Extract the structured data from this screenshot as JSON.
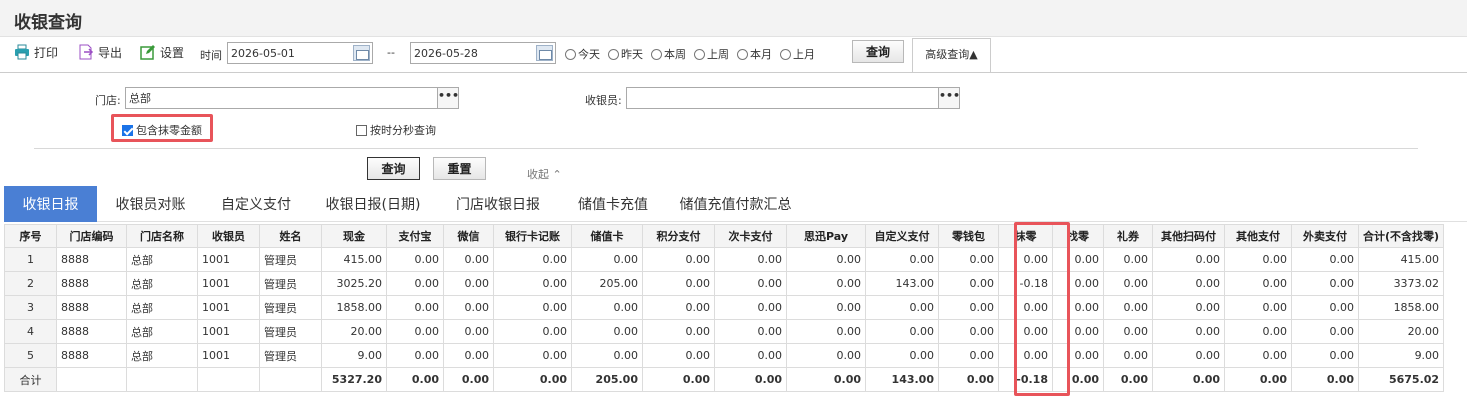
{
  "page": {
    "title": "收银查询"
  },
  "toolbar": {
    "print_label": "打印",
    "export_label": "导出",
    "settings_label": "设置",
    "time_label": "时间",
    "date_from": "2026-05-01",
    "date_sep": "--",
    "date_to": "2026-05-28",
    "radios": [
      "今天",
      "昨天",
      "本周",
      "上周",
      "本月",
      "上月"
    ],
    "query_label": "查询",
    "advanced_label": "高级查询▲"
  },
  "advanced": {
    "store_label": "门店:",
    "store_value": "总部",
    "cashier_label": "收银员:",
    "cashier_value": "",
    "dots": "•••",
    "include_rounding_label": "包含抹零金额",
    "include_rounding_checked": true,
    "by_seconds_label": "按时分秒查询",
    "by_seconds_checked": false,
    "query_label": "查询",
    "reset_label": "重置",
    "collapse_label": "收起 ⌃"
  },
  "tabs": [
    "收银日报",
    "收银员对账",
    "自定义支付",
    "收银日报(日期)",
    "门店收银日报",
    "储值卡充值",
    "储值充值付款汇总"
  ],
  "active_tab": 0,
  "table": {
    "columns": [
      "序号",
      "门店编码",
      "门店名称",
      "收银员",
      "姓名",
      "现金",
      "支付宝",
      "微信",
      "银行卡记账",
      "储值卡",
      "积分支付",
      "次卡支付",
      "思迅Pay",
      "自定义支付",
      "零钱包",
      "抹零",
      "找零",
      "礼券",
      "其他扫码付",
      "其他支付",
      "外卖支付",
      "合计(不含找零)"
    ],
    "rows": [
      [
        "1",
        "8888",
        "总部",
        "1001",
        "管理员",
        "415.00",
        "0.00",
        "0.00",
        "0.00",
        "0.00",
        "0.00",
        "0.00",
        "0.00",
        "0.00",
        "0.00",
        "0.00",
        "0.00",
        "0.00",
        "0.00",
        "0.00",
        "0.00",
        "415.00"
      ],
      [
        "2",
        "8888",
        "总部",
        "1001",
        "管理员",
        "3025.20",
        "0.00",
        "0.00",
        "0.00",
        "205.00",
        "0.00",
        "0.00",
        "0.00",
        "143.00",
        "0.00",
        "-0.18",
        "0.00",
        "0.00",
        "0.00",
        "0.00",
        "0.00",
        "3373.02"
      ],
      [
        "3",
        "8888",
        "总部",
        "1001",
        "管理员",
        "1858.00",
        "0.00",
        "0.00",
        "0.00",
        "0.00",
        "0.00",
        "0.00",
        "0.00",
        "0.00",
        "0.00",
        "0.00",
        "0.00",
        "0.00",
        "0.00",
        "0.00",
        "0.00",
        "1858.00"
      ],
      [
        "4",
        "8888",
        "总部",
        "1001",
        "管理员",
        "20.00",
        "0.00",
        "0.00",
        "0.00",
        "0.00",
        "0.00",
        "0.00",
        "0.00",
        "0.00",
        "0.00",
        "0.00",
        "0.00",
        "0.00",
        "0.00",
        "0.00",
        "0.00",
        "20.00"
      ],
      [
        "5",
        "8888",
        "总部",
        "1001",
        "管理员",
        "9.00",
        "0.00",
        "0.00",
        "0.00",
        "0.00",
        "0.00",
        "0.00",
        "0.00",
        "0.00",
        "0.00",
        "0.00",
        "0.00",
        "0.00",
        "0.00",
        "0.00",
        "0.00",
        "9.00"
      ]
    ],
    "total": [
      "合计",
      "",
      "",
      "",
      "",
      "5327.20",
      "0.00",
      "0.00",
      "0.00",
      "205.00",
      "0.00",
      "0.00",
      "0.00",
      "143.00",
      "0.00",
      "-0.18",
      "0.00",
      "0.00",
      "0.00",
      "0.00",
      "0.00",
      "5675.02"
    ]
  },
  "colors": {
    "tab_active": "#4a7fd4",
    "highlight": "#e8545a",
    "checkbox_on": "#1a73e8"
  }
}
